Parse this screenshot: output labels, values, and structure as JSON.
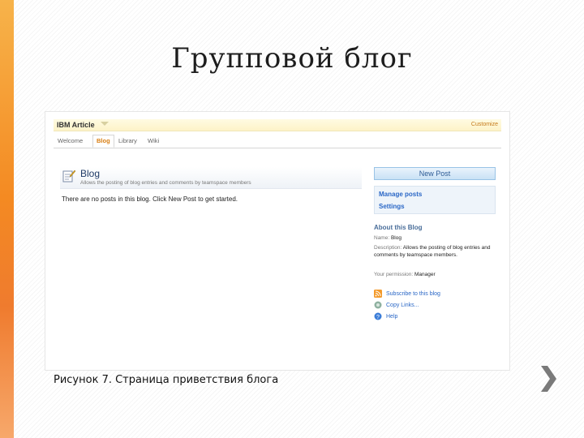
{
  "slide": {
    "title": "Групповой блог",
    "caption": "Рисунок 7. Страница приветствия блога"
  },
  "app": {
    "title": "IBM Article",
    "customize_label": "Customize",
    "tabs": [
      {
        "label": "Welcome",
        "active": false
      },
      {
        "label": "Blog",
        "active": true
      },
      {
        "label": "Library",
        "active": false
      },
      {
        "label": "Wiki",
        "active": false
      }
    ]
  },
  "blog": {
    "title": "Blog",
    "description": "Allows the posting of blog entries and comments by teamspace members",
    "empty_message": "There are no posts in this blog. Click New Post to get started."
  },
  "sidebar": {
    "new_post_label": "New Post",
    "manage_posts_label": "Manage posts",
    "settings_label": "Settings",
    "about_heading": "About this Blog",
    "name_label": "Name:",
    "name_value": "Blog",
    "description_label": "Description:",
    "description_value": "Allows the posting of blog entries and comments by teamspace members.",
    "permission_label": "Your permission:",
    "permission_value": "Manager",
    "links": [
      {
        "label": "Subscribe to this blog",
        "icon": "rss-icon"
      },
      {
        "label": "Copy Links...",
        "icon": "copy-links-icon"
      },
      {
        "label": "Help",
        "icon": "help-icon"
      }
    ]
  },
  "colors": {
    "accent_orange": "#f48a22",
    "link_blue": "#2a67c6",
    "active_tab": "#d87e12"
  }
}
